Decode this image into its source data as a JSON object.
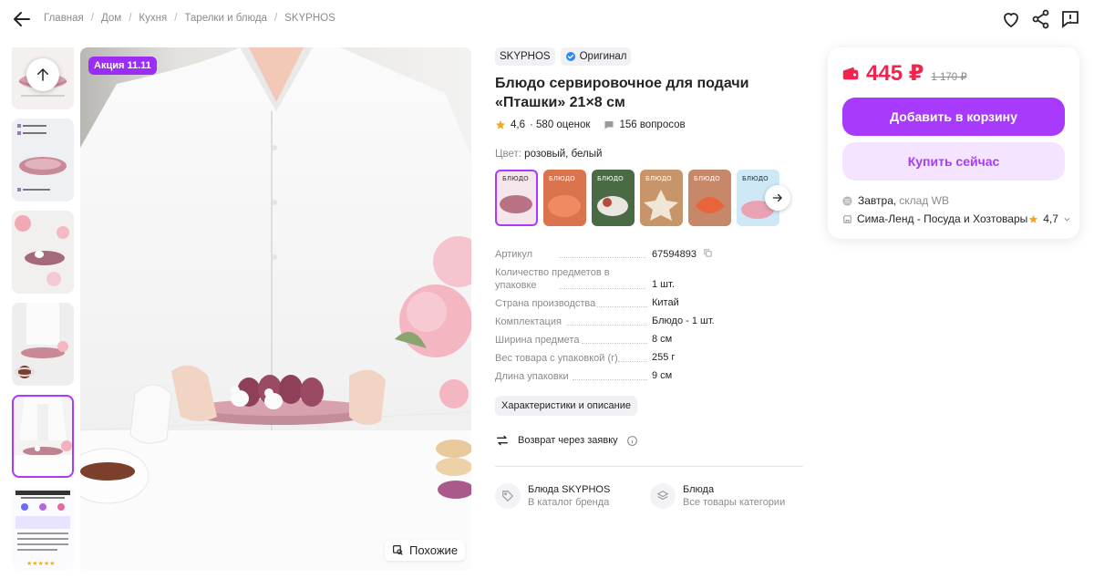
{
  "breadcrumb": [
    "Главная",
    "Дом",
    "Кухня",
    "Тарелки и блюда",
    "SKYPHOS"
  ],
  "header_icons": [
    "heart-icon",
    "share-icon",
    "report-icon"
  ],
  "gallery": {
    "promo_badge": "Акция 11.11",
    "similar_label": "Похожие",
    "active_thumb": 4
  },
  "product": {
    "brand": "SKYPHOS",
    "original_label": "Оригинал",
    "title": "Блюдо сервировочное для подачи «Пташки» 21×8 см",
    "rating": "4,6",
    "reviews": "· 580 оценок",
    "questions": "156 вопросов",
    "color_label": "Цвет:",
    "color_value": "розовый, белый"
  },
  "specs": [
    {
      "key": "Артикул",
      "value": "67594893"
    },
    {
      "key": "Количество предметов в упаковке",
      "value": "1 шт."
    },
    {
      "key": "Страна производства",
      "value": "Китай"
    },
    {
      "key": "Комплектация",
      "value": "Блюдо - 1 шт."
    },
    {
      "key": "Ширина предмета",
      "value": "8 см"
    },
    {
      "key": "Вес товара с упаковкой (г)",
      "value": "255 г"
    },
    {
      "key": "Длина упаковки",
      "value": "9 см"
    }
  ],
  "characteristics_label": "Характеристики и описание",
  "return_label": "Возврат через заявку",
  "links": [
    {
      "title": "Блюда SKYPHOS",
      "subtitle": "В каталог бренда"
    },
    {
      "title": "Блюда",
      "subtitle": "Все товары категории"
    }
  ],
  "buy": {
    "price": "445 ₽",
    "old_price": "1 170 ₽",
    "add_to_cart": "Добавить в корзину",
    "buy_now": "Купить сейчас",
    "delivery": "Завтра,",
    "warehouse": "склад WB",
    "seller": "Сима-Ленд - Посуда и Хозтовары",
    "seller_rating": "4,7"
  },
  "colors": {
    "accent": "#a73afd",
    "price": "#f0244d",
    "badge": "#9b2df4"
  }
}
